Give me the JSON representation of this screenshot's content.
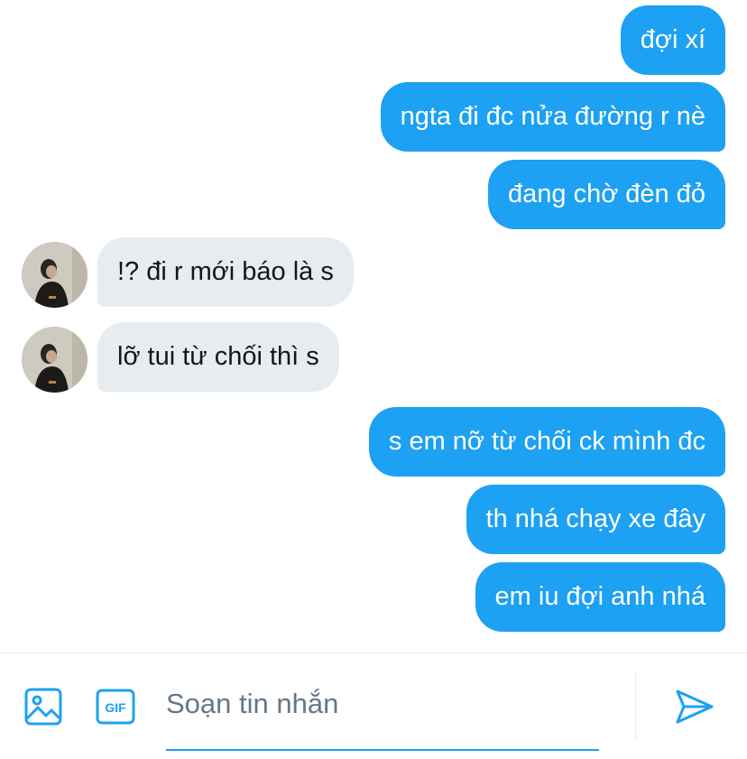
{
  "messages": [
    {
      "side": "out",
      "text": "đợi xí"
    },
    {
      "side": "out",
      "text": "ngta đi đc nửa đường r nè"
    },
    {
      "side": "out",
      "text": "đang chờ đèn đỏ"
    },
    {
      "side": "in",
      "text": "!? đi r mới báo là s"
    },
    {
      "side": "in",
      "text": "lỡ tui từ chối thì s"
    },
    {
      "side": "out",
      "text": "s em nỡ từ chối ck mình đc"
    },
    {
      "side": "out",
      "text": "th nhá chạy xe đây"
    },
    {
      "side": "out",
      "text": "em iu đợi anh nhá"
    }
  ],
  "composer": {
    "placeholder": "Soạn tin nhắn",
    "gif_label": "GIF",
    "icons": [
      "image-icon",
      "gif-icon",
      "send-icon"
    ]
  },
  "colors": {
    "accent": "#1da1f2",
    "incoming_bubble": "#e6ecf0",
    "placeholder": "#657786"
  }
}
